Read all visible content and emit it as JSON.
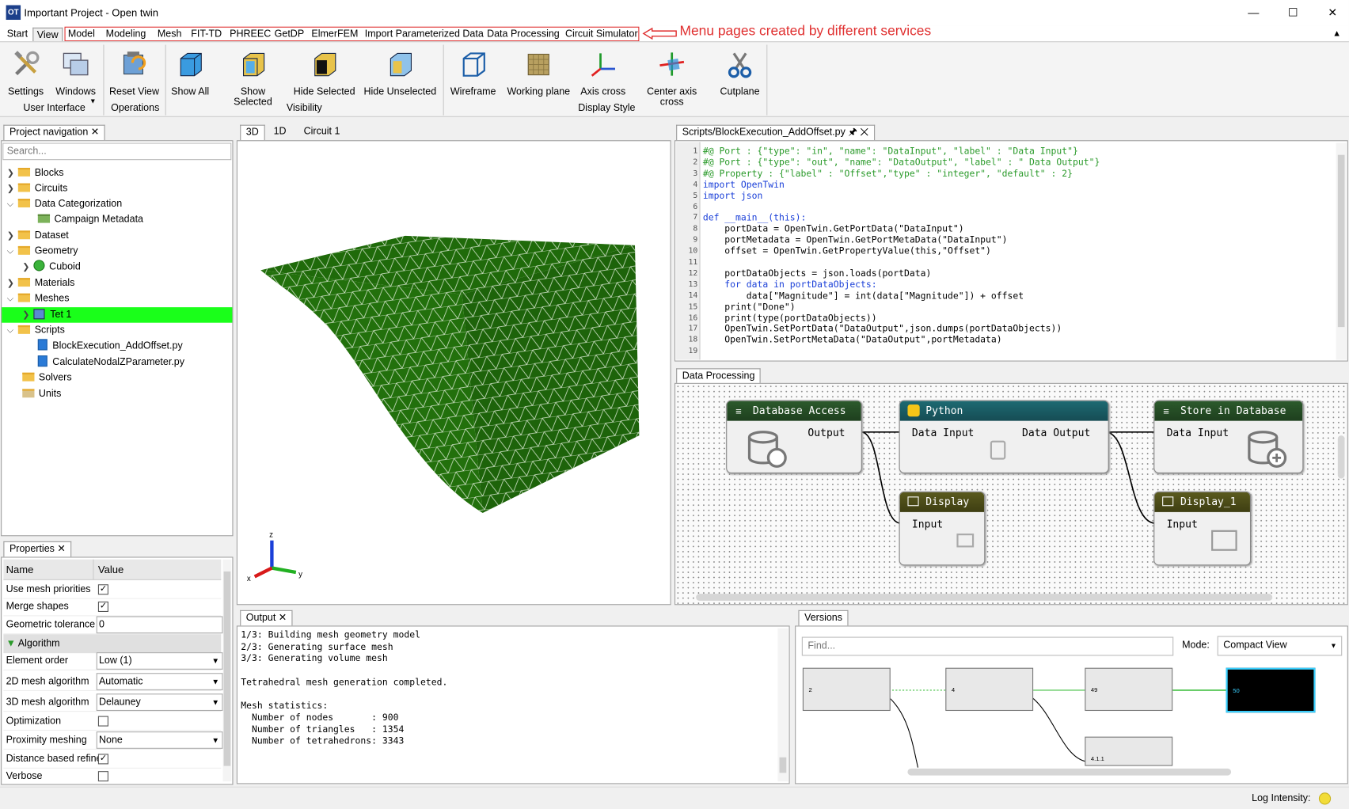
{
  "window": {
    "title": "Important Project - Open twin",
    "icon_text": "OT",
    "minimize": "—",
    "maximize": "☐",
    "close": "✕"
  },
  "menu": {
    "tabs": [
      "Start",
      "View"
    ],
    "service_tabs": [
      "Model",
      "Modeling",
      "Mesh",
      "FIT-TD",
      "PHREEC",
      "GetDP",
      "ElmerFEM",
      "Import Parameterized Data",
      "Data Processing",
      "Circuit Simulator"
    ],
    "annotation": "Menu pages created by different services",
    "collapse": "▲"
  },
  "ribbon": {
    "buttons": [
      "Settings",
      "Windows",
      "Reset View",
      "Show All",
      "Show Selected",
      "Hide Selected",
      "Hide Unselected",
      "Wireframe",
      "Working plane",
      "Axis cross",
      "Center axis cross",
      "Cutplane"
    ],
    "groups": [
      "User Interface",
      "Operations",
      "Visibility",
      "Display Style"
    ]
  },
  "project_navigation": {
    "tab": "Project navigation",
    "search_placeholder": "Search...",
    "items": [
      "Blocks",
      "Circuits",
      "Data Categorization",
      "Campaign Metadata",
      "Dataset",
      "Geometry",
      "Cuboid",
      "Materials",
      "Meshes",
      "Tet 1",
      "Scripts",
      "BlockExecution_AddOffset.py",
      "CalculateNodalZParameter.py",
      "Solvers",
      "Units"
    ]
  },
  "properties": {
    "tab": "Properties",
    "col_name": "Name",
    "col_value": "Value",
    "rows": [
      {
        "name": "Use mesh priorities",
        "value": "✓"
      },
      {
        "name": "Merge shapes",
        "value": "✓"
      },
      {
        "name": "Geometric tolerance",
        "value": "0"
      },
      {
        "name": "Algorithm",
        "value": ""
      },
      {
        "name": "Element order",
        "value": "Low (1)"
      },
      {
        "name": "2D mesh algorithm",
        "value": "Automatic"
      },
      {
        "name": "3D mesh algorithm",
        "value": "Delauney"
      },
      {
        "name": "Optimization",
        "value": ""
      },
      {
        "name": "Proximity meshing",
        "value": "None"
      },
      {
        "name": "Distance based refine",
        "value": "✓"
      },
      {
        "name": "Verbose",
        "value": ""
      }
    ]
  },
  "viewer": {
    "tabs": [
      "3D",
      "1D",
      "Circuit 1"
    ],
    "axes": [
      "z",
      "y",
      "x"
    ],
    "mesh_color": "#1f6a0a"
  },
  "script_editor": {
    "tab": "Scripts/BlockExecution_AddOffset.py",
    "pin": "🖈",
    "close": "✕",
    "lines": [
      "#@ Port : {\"type\": \"in\", \"name\": \"DataInput\", \"label\" : \"Data Input\"}",
      "#@ Port : {\"type\": \"out\", \"name\": \"DataOutput\", \"label\" : \" Data Output\"}",
      "#@ Property : {\"label\" : \"Offset\",\"type\" : \"integer\", \"default\" : 2}",
      "import OpenTwin",
      "import json",
      "",
      "def __main__(this):",
      "    portData = OpenTwin.GetPortData(\"DataInput\")",
      "    portMetadata = OpenTwin.GetPortMetaData(\"DataInput\")",
      "    offset = OpenTwin.GetPropertyValue(this,\"Offset\")",
      "",
      "    portDataObjects = json.loads(portData)",
      "    for data in portDataObjects:",
      "        data[\"Magnitude\"] = int(data[\"Magnitude\"]) + offset",
      "    print(\"Done\")",
      "    print(type(portDataObjects))",
      "    OpenTwin.SetPortData(\"DataOutput\",json.dumps(portDataObjects))",
      "    OpenTwin.SetPortMetaData(\"DataOutput\",portMetadata)",
      ""
    ]
  },
  "data_processing": {
    "tab": "Data Processing",
    "nodes": [
      {
        "title": "Database Access",
        "ports": [
          "Output"
        ]
      },
      {
        "title": "Python",
        "ports": [
          "Data Input",
          "Data Output"
        ]
      },
      {
        "title": "Store in Database",
        "ports": [
          "Data Input"
        ]
      },
      {
        "title": "Display",
        "ports": [
          "Input"
        ]
      },
      {
        "title": "Display_1",
        "ports": [
          "Input"
        ]
      }
    ]
  },
  "output": {
    "tab": "Output",
    "lines": [
      "1/3: Building mesh geometry model",
      "2/3: Generating surface mesh",
      "3/3: Generating volume mesh",
      "",
      "Tetrahedral mesh generation completed.",
      "",
      "Mesh statistics:",
      "  Number of nodes       : 900",
      "  Number of triangles   : 1354",
      "  Number of tetrahedrons: 3343"
    ]
  },
  "versions": {
    "tab": "Versions",
    "find_placeholder": "Find...",
    "mode_label": "Mode:",
    "mode_value": "Compact View",
    "nodes": [
      "2",
      "4",
      "49",
      "50",
      "4.1.1"
    ]
  },
  "status": {
    "log_label": "Log Intensity:"
  }
}
